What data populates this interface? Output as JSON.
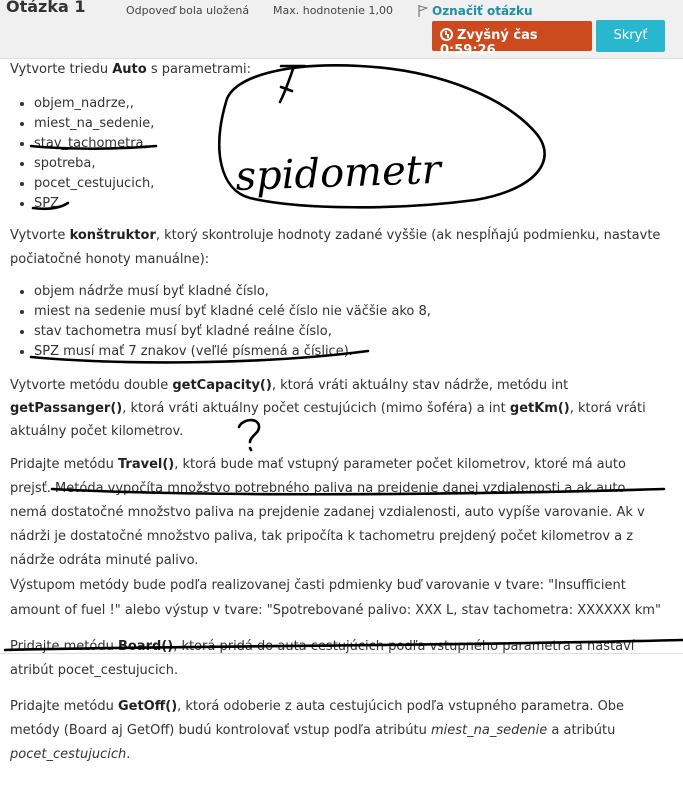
{
  "header": {
    "question_title": "Otázka 1",
    "status": "Odpoveď bola uložená",
    "max_score": "Max. hodnotenie 1,00",
    "flag_label": "Označiť otázku",
    "timer": "Zvyšný čas 0:59:26",
    "hide_button": "Skryť"
  },
  "question": {
    "p1": {
      "pre": "Vytvorte triedu ",
      "class_name": "Auto",
      "post": " s parametrami:"
    },
    "params": [
      "objem_nadrze,,",
      "miest_na_sedenie,",
      "stav_tachometra,",
      "spotreba,",
      "pocet_cestujucich,",
      "SPZ."
    ],
    "p2": {
      "pre": "Vytvorte ",
      "bold": "konštruktor",
      "post": ", ktorý skontroluje hodnoty zadané vyššie (ak nespĺňajú podmienku, nastavte počiatočné honoty manuálne):"
    },
    "conditions": [
      "objem nádrže musí byť kladné číslo,",
      "miest na sedenie musí byť kladné celé číslo nie väčšie ako 8,",
      "stav tachometra musí byť kladné reálne číslo,",
      "SPZ musí mať 7 znakov (veľlé písmená a číslice)."
    ],
    "p3": {
      "a": "Vytvorte metódu double ",
      "m1": "getCapacity()",
      "b": ", ktorá vráti aktuálny stav nádrže, metódu int ",
      "m2": "getPassanger()",
      "c": ", ktorá vráti aktuálny počet cestujúcich (mimo šoféra) a int ",
      "m3": "getKm()",
      "d": ", ktorá vráti aktuálny počet kilometrov."
    },
    "p4": {
      "a": "Pridajte metódu ",
      "m": "Travel()",
      "b": ", ktorá bude mať vstupný parameter počet kilometrov, ktoré má auto prejsť. Metóda vypočíta množstvo potrebného paliva na prejdenie danej vzdialenosti a ak auto nemá dostatočné množstvo paliva na prejdenie zadanej vzdialenosti, auto vypíše varovanie. Ak v nádrži je dostatočné množstvo paliva, tak pripočíta k tachometru prejdený počet kilometrov a z nádrže odráta minuté palivo.",
      "c": "Výstupom metódy bude podľa realizovanej časti pdmienky buď varovanie v tvare: \"Insufficient amount of fuel !\"  alebo výstup v tvare: \"Spotrebované palivo: XXX L, stav tachometra: XXXXXX km\""
    },
    "p5": {
      "a": "Pridajte metódu ",
      "m": "Board()",
      "b": ", ktorá pridá do auta cestujúcich podľa vstupného parametra a nastaví atribút pocet_cestujucich."
    },
    "p6": {
      "a": "Pridajte metódu ",
      "m": "GetOff()",
      "b": ", ktorá odoberie z auta cestujúcich podľa vstupného parametra. Obe metódy (Board aj GetOff) budú kontrolovať vstup podľa atribútu ",
      "i1": "miest_na_sedenie",
      "c": " a atribútu ",
      "i2": "pocet_cestujucich",
      "d": "."
    }
  },
  "handwriting": {
    "word": "spidometr",
    "mark_t": "t",
    "question_mark": "?"
  },
  "colors": {
    "timer_bg": "#cc4a1d",
    "button_bg": "#29b7cf",
    "flag_link": "#1f8ea8",
    "ink": "#000000"
  }
}
